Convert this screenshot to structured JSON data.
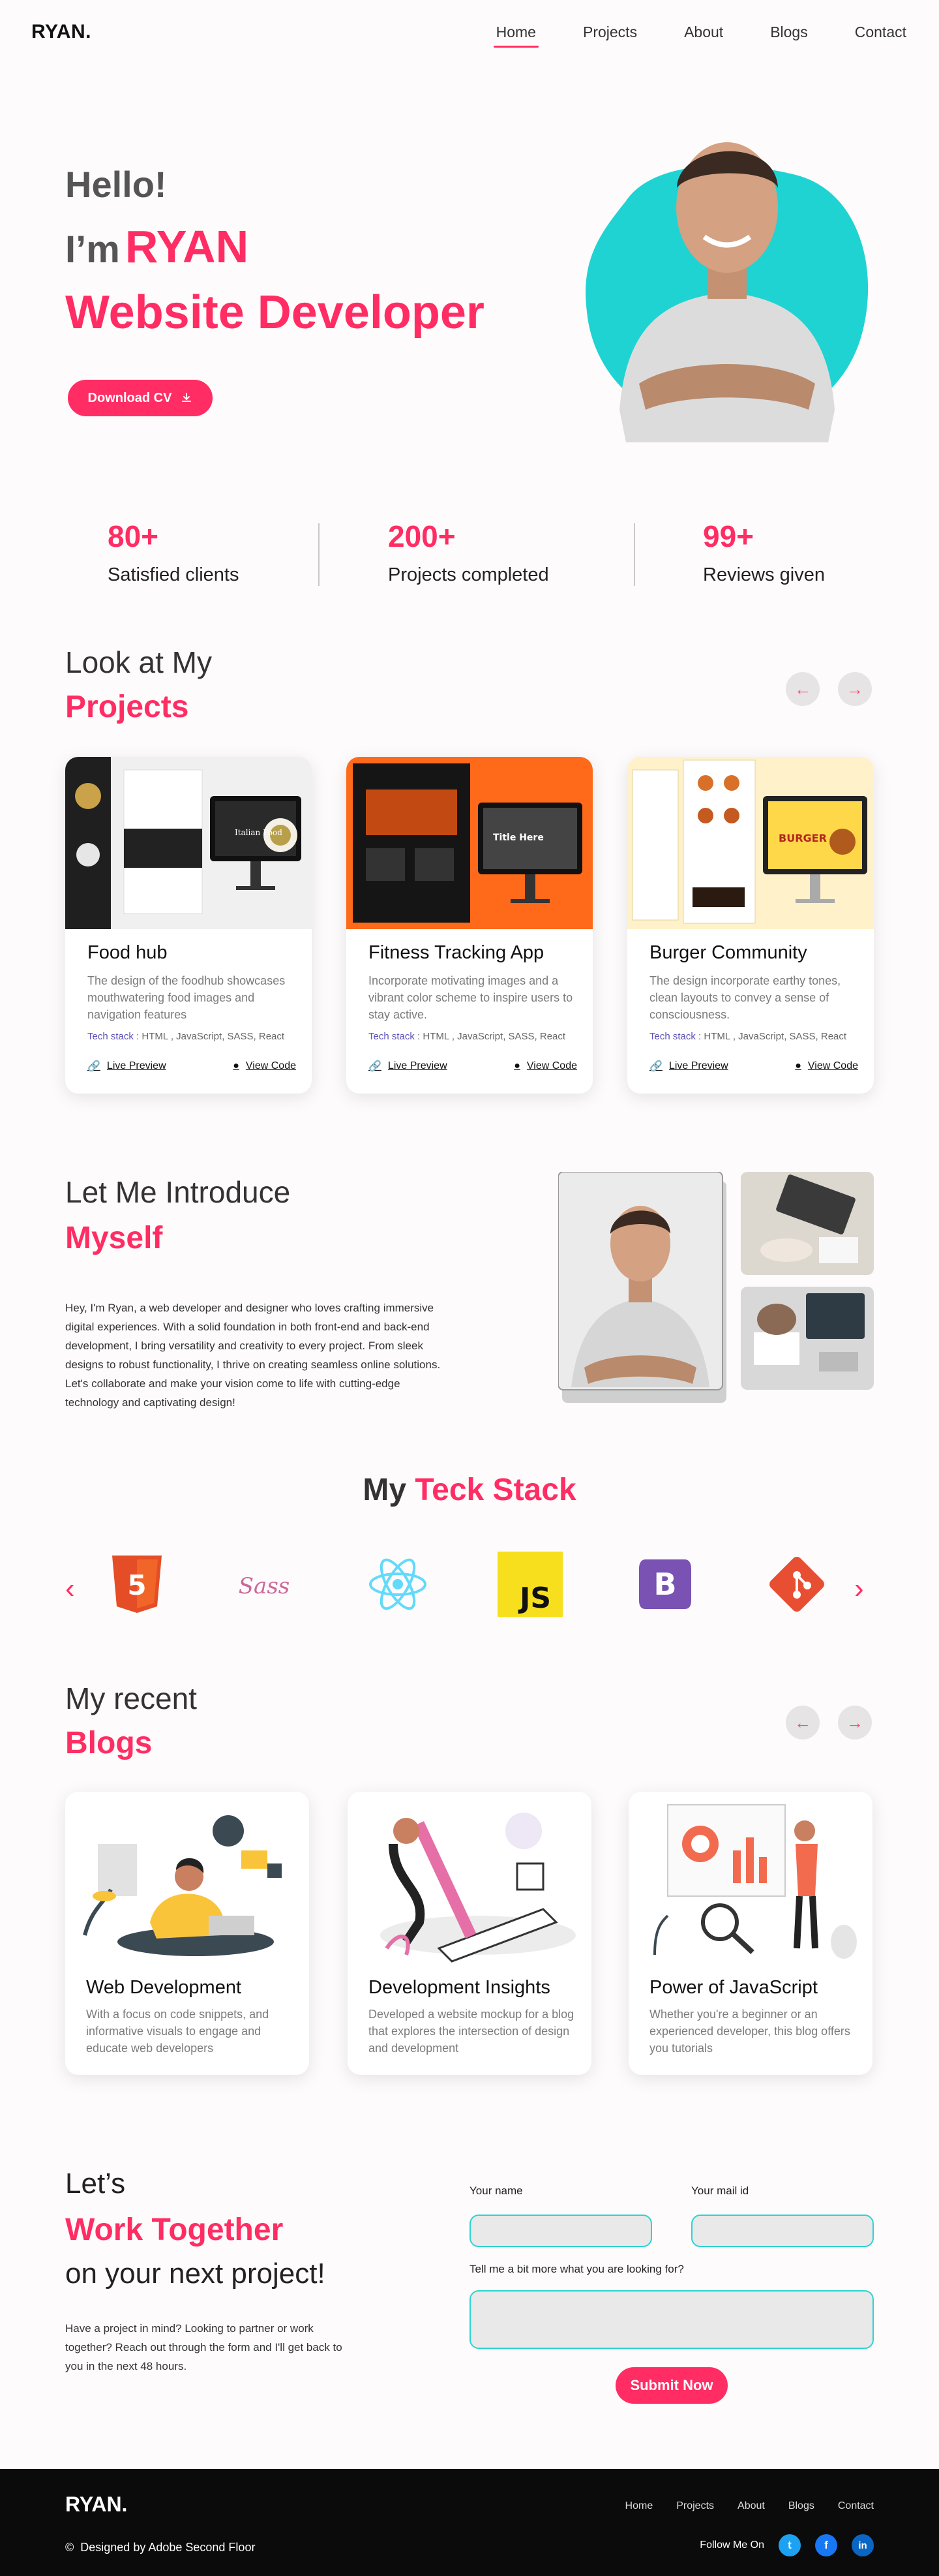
{
  "nav": {
    "logo": "RYAN.",
    "links": [
      "Home",
      "Projects",
      "About",
      "Blogs",
      "Contact"
    ]
  },
  "hero": {
    "greeting": "Hello!",
    "im": "I’m",
    "name": "RYAN",
    "role": "Website Developer",
    "cv_button": "Download CV"
  },
  "stats": [
    {
      "num": "80+",
      "label": "Satisfied clients"
    },
    {
      "num": "200+",
      "label": "Projects completed"
    },
    {
      "num": "99+",
      "label": "Reviews given"
    }
  ],
  "projects": {
    "heading_1": "Look at My",
    "heading_2": "Projects",
    "tech_label": "Tech stack",
    "live_label": "Live Preview",
    "code_label": "View Code",
    "cards": [
      {
        "title": "Food hub",
        "desc": "The design of the foodhub showcases mouthwatering food images and navigation features",
        "tech": "HTML , JavaScript, SASS, React"
      },
      {
        "title": "Fitness Tracking App",
        "desc": "Incorporate motivating images and a vibrant color scheme to inspire users to stay active.",
        "tech": "HTML , JavaScript, SASS, React"
      },
      {
        "title": "Burger Community",
        "desc": "The design incorporate earthy tones, clean layouts to convey a sense of consciousness.",
        "tech": "HTML , JavaScript, SASS, React"
      }
    ],
    "thumb_texts": {
      "food": "Italian Food",
      "fit": "Title Here",
      "burger": "BURGER"
    }
  },
  "about": {
    "heading_1": "Let Me Introduce",
    "heading_2": "Myself",
    "text": "Hey, I'm Ryan, a web developer and designer who loves crafting immersive digital experiences. With a solid foundation in both front-end and back-end development, I bring versatility and creativity to every project. From sleek designs to robust functionality, I thrive on creating seamless online solutions. Let's collaborate and make your vision come to life with cutting-edge technology and captivating design!"
  },
  "stack": {
    "title_1": "My",
    "title_2": "Teck Stack",
    "js_text": "JS",
    "bs_text": "B",
    "html_text": "5",
    "sass_text": "Sass"
  },
  "blogs": {
    "heading_1": "My recent",
    "heading_2": "Blogs",
    "cards": [
      {
        "title": "Web Development",
        "desc": "With a focus on code snippets, and informative visuals to engage and educate web developers"
      },
      {
        "title": "Development Insights",
        "desc": "Developed a website mockup for a blog that explores the intersection of design and development"
      },
      {
        "title": "Power of JavaScript",
        "desc": "Whether you're a beginner or an experienced developer, this blog offers you tutorials"
      }
    ]
  },
  "contact": {
    "heading_1": "Let’s",
    "heading_2": "Work Together",
    "heading_3": "on your next project!",
    "text": "Have a project in mind? Looking to partner or work together? Reach out through the form and I'll get back to you in the next 48 hours.",
    "name_label": "Your name",
    "mail_label": "Your mail id",
    "message_label": "Tell me a bit more what you are looking for?",
    "submit": "Submit Now"
  },
  "footer": {
    "logo": "RYAN.",
    "copyright": "Designed by Adobe Second Floor",
    "links": [
      "Home",
      "Projects",
      "About",
      "Blogs",
      "Contact"
    ],
    "follow": "Follow Me On"
  },
  "colors": {
    "accent": "#ff2d63",
    "teal": "#1fd3d3",
    "footer_bg": "#0b0b0b"
  }
}
